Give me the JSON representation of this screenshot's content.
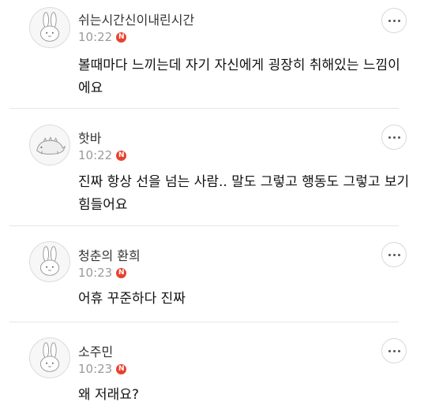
{
  "comments": [
    {
      "username": "쉬는시간신이내린시간",
      "time": "10:22",
      "new_badge": "N",
      "avatar_icon": "bunny-icon",
      "text": "볼때마다 느끼는데 자기 자신에게 굉장히 취해있는 느낌이에요"
    },
    {
      "username": "핫바",
      "time": "10:22",
      "new_badge": "N",
      "avatar_icon": "dinosaur-icon",
      "text": "진짜 항상 선을 넘는 사람.. 말도 그렇고 행동도 그렇고 보기 힘들어요"
    },
    {
      "username": "청춘의 환희",
      "time": "10:23",
      "new_badge": "N",
      "avatar_icon": "bunny-icon",
      "text": "어휴 꾸준하다 진짜"
    },
    {
      "username": "소주민",
      "time": "10:23",
      "new_badge": "N",
      "avatar_icon": "bunny-icon",
      "text": "왜 저래요?"
    }
  ],
  "colors": {
    "badge": "#e8412e",
    "divider": "#e6e6e6",
    "time": "#9a9a9a"
  }
}
